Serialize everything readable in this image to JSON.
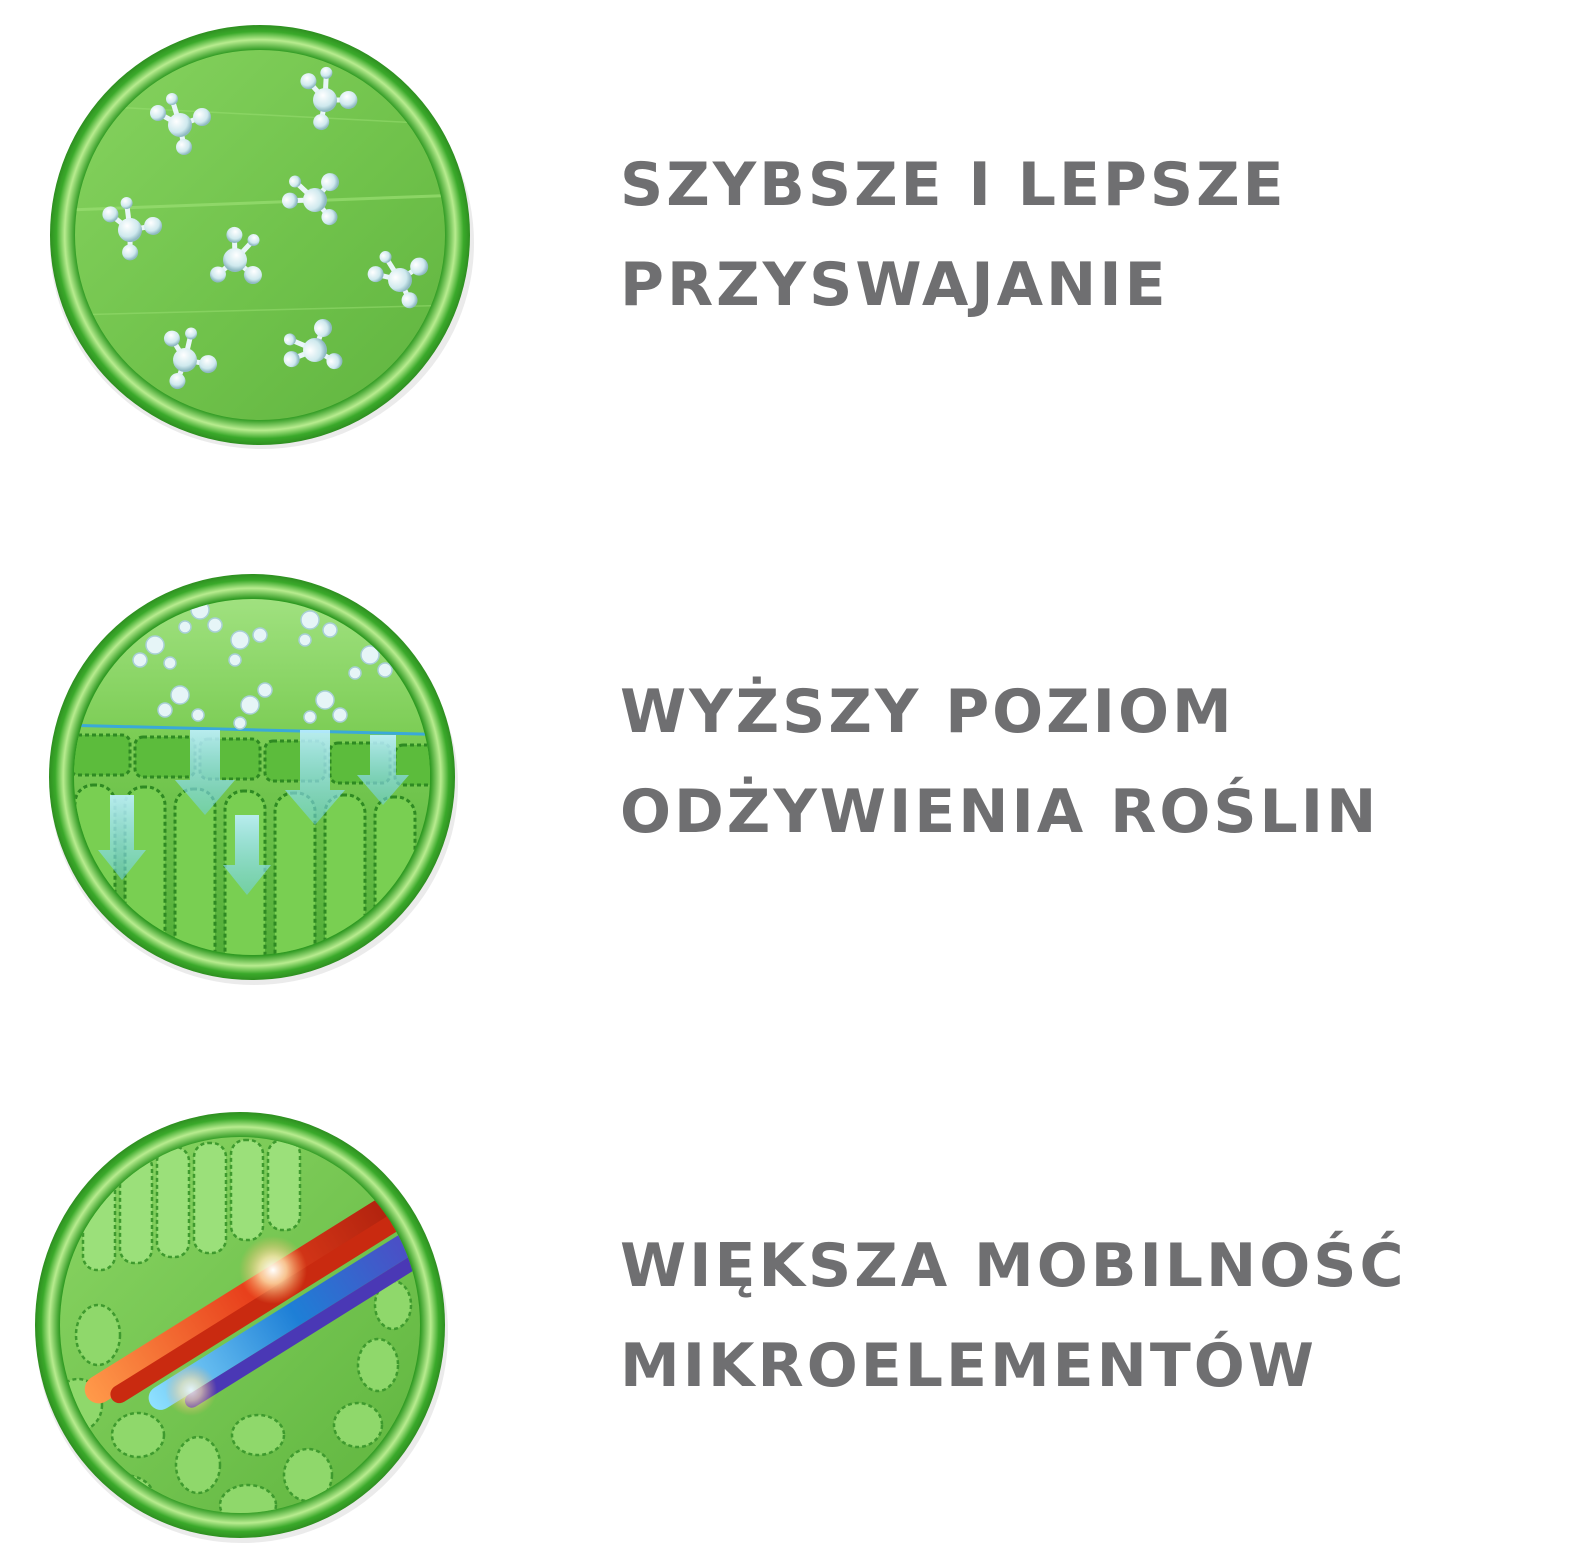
{
  "features": [
    {
      "icon": "molecules-on-leaf-icon",
      "line1": "SZYBSZE I LEPSZE",
      "line2": "PRZYSWAJANIE"
    },
    {
      "icon": "leaf-cells-absorption-icon",
      "line1": "WYŻSZY POZIOM",
      "line2": "ODŻYWIENIA ROŚLIN"
    },
    {
      "icon": "plant-vascular-transport-icon",
      "line1": "WIĘKSZA MOBILNOŚĆ",
      "line2": "MIKROELEMENTÓW"
    }
  ],
  "colors": {
    "text": "#6f6f71",
    "ring": "#3fae2a",
    "leaf": "#7cc957",
    "molecule": "#d8eef0",
    "red_vessel": "#e8401c",
    "blue_vessel": "#1e7fd6",
    "purple_vessel": "#5a3fc0"
  }
}
